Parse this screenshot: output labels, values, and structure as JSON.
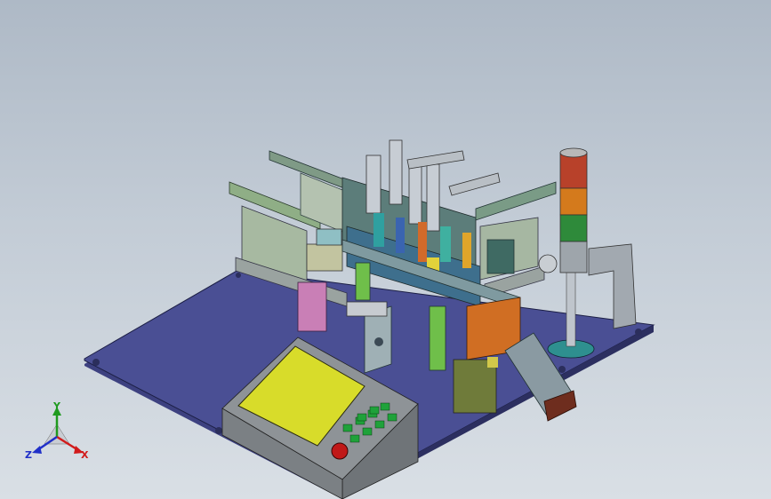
{
  "viewport": {
    "background_top": "#aeb9c6",
    "background_bottom": "#d9dfe5"
  },
  "model": {
    "base_color": "#4a4f94",
    "screen_color": "#d8dc2a",
    "button_color": "#1fa23a",
    "estop_color": "#c01818",
    "panel_color": "#9fa3a8"
  },
  "stack_light": {
    "colors": [
      "#b8412a",
      "#d47a1c",
      "#2e8a3a",
      "#b8b8b8"
    ]
  },
  "triad": {
    "x_label": "X",
    "y_label": "Y",
    "z_label": "Z",
    "x_color": "#d11b1b",
    "y_color": "#1f9a1f",
    "z_color": "#2030c8"
  }
}
